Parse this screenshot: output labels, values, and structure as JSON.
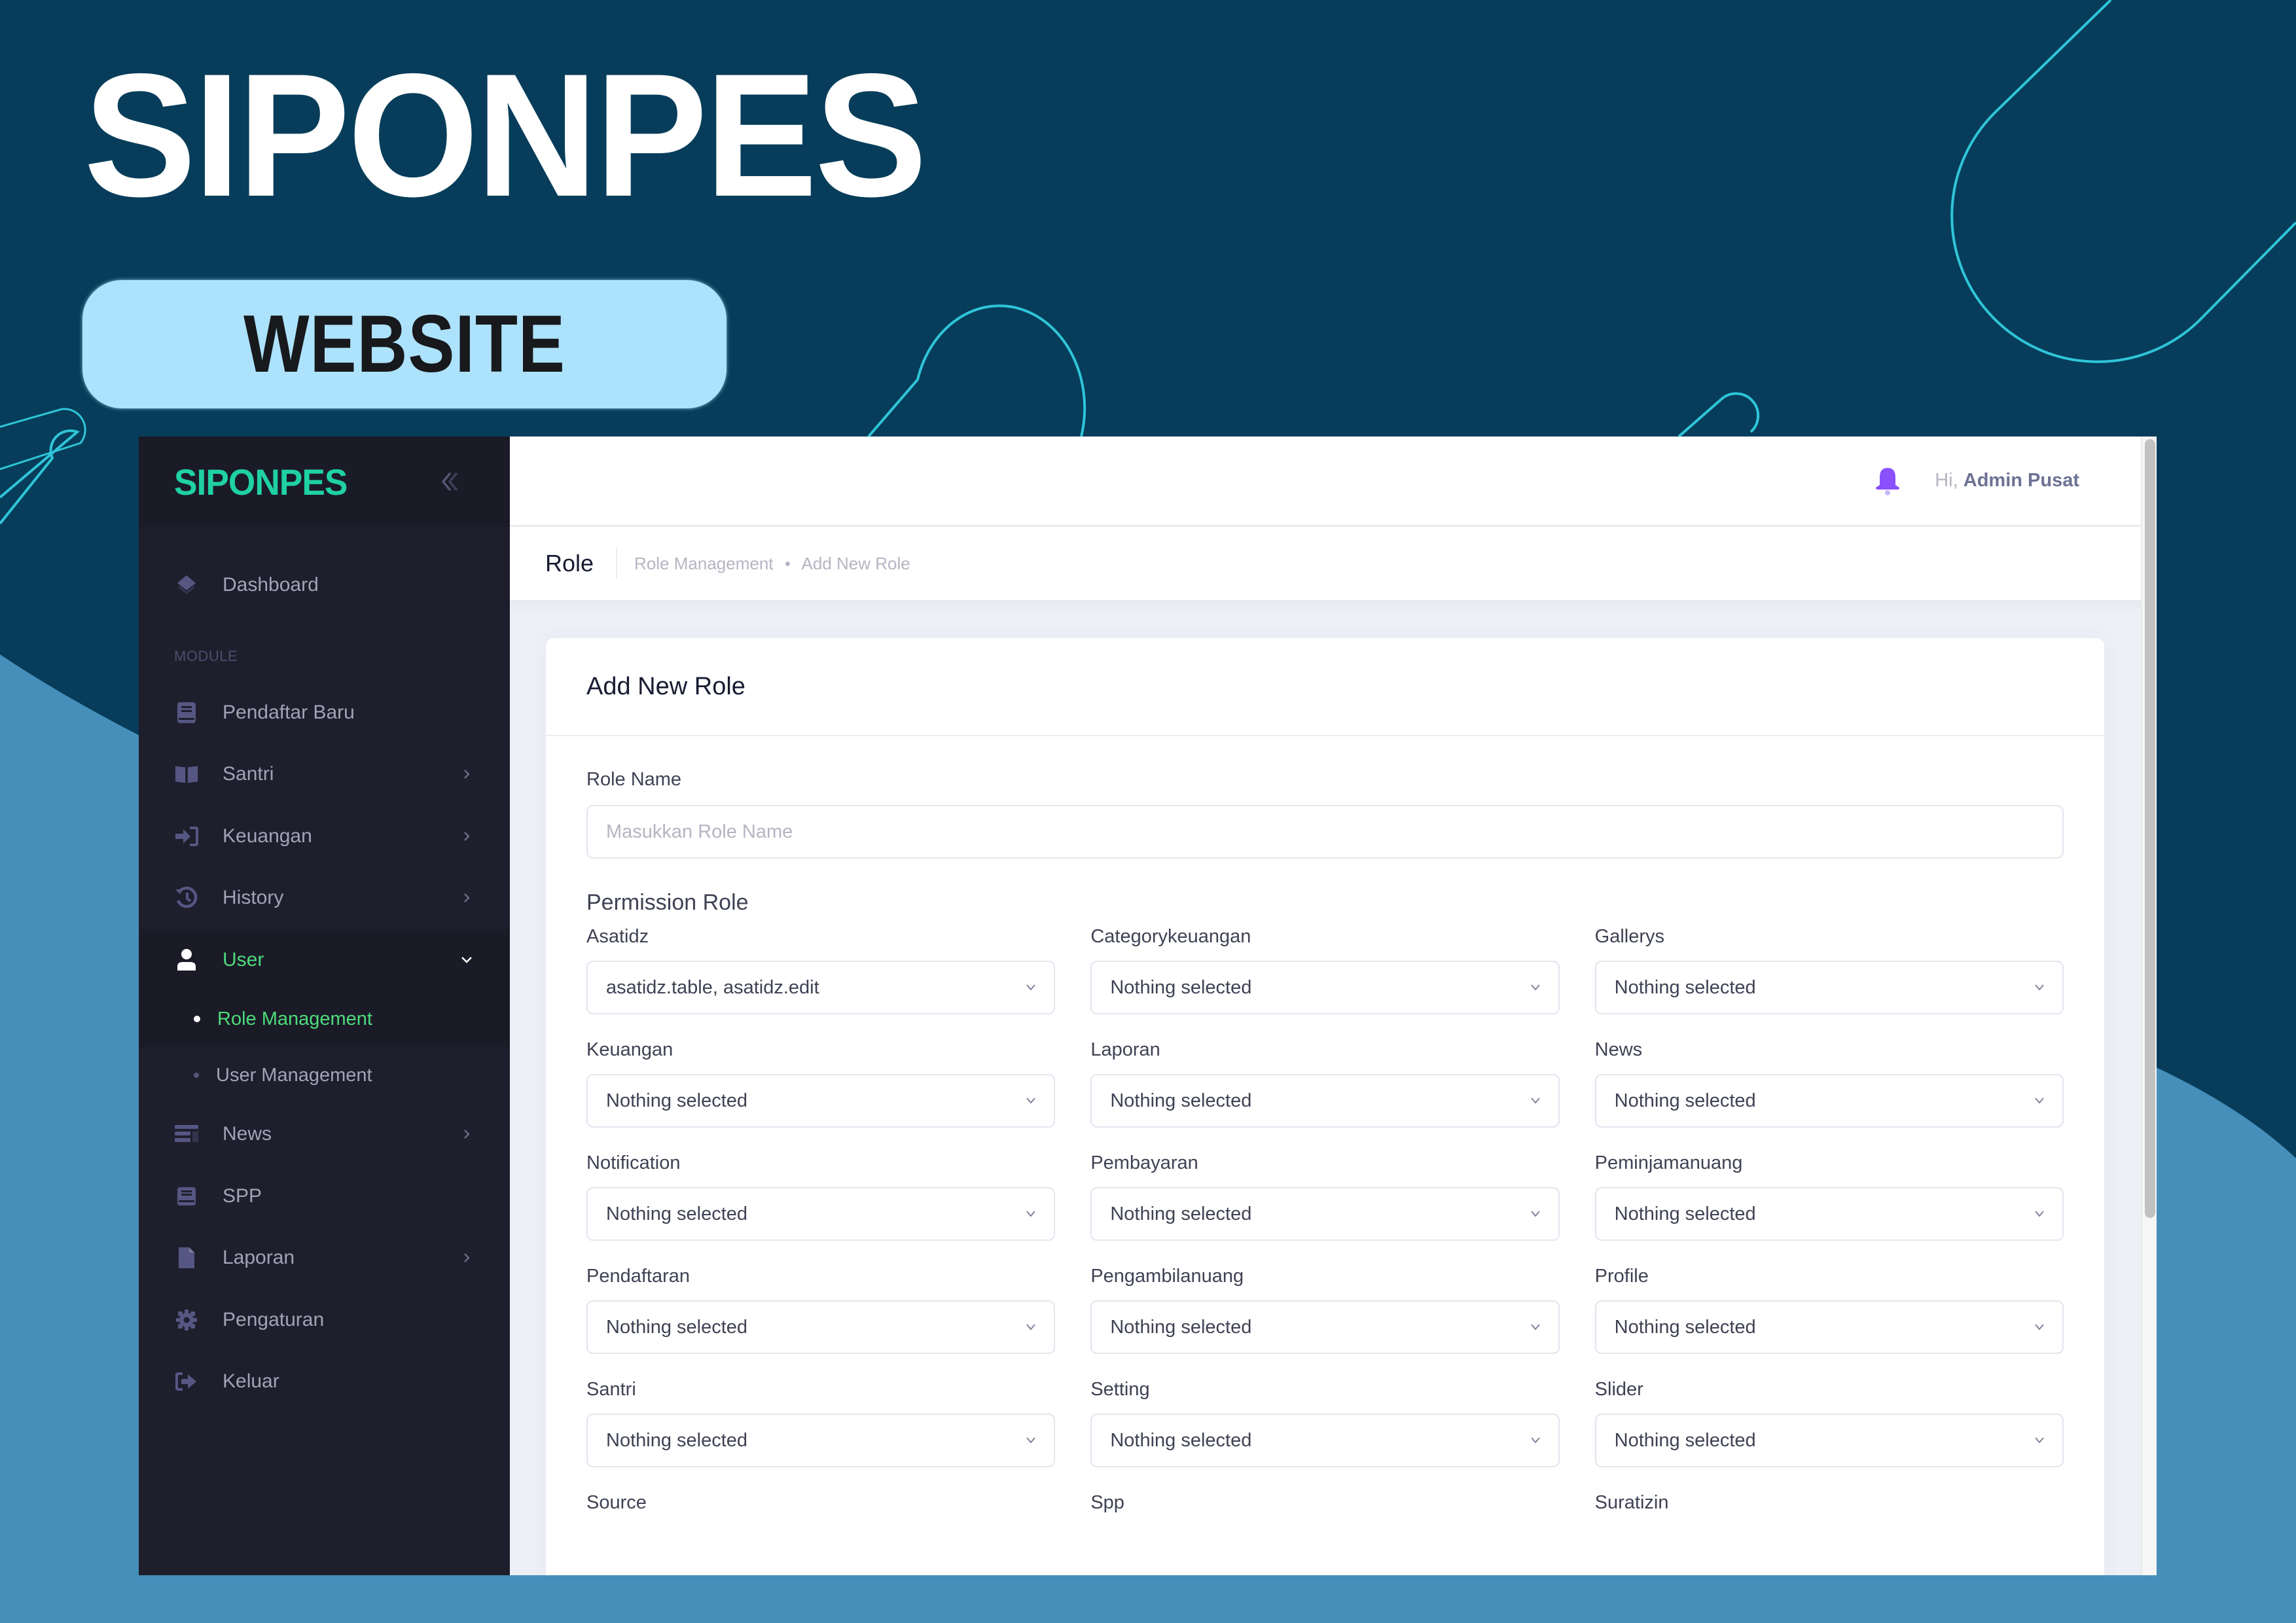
{
  "banner": {
    "title": "SIPONPES",
    "subtitle": "WEBSITE"
  },
  "colors": {
    "background_dark": "#073d5a",
    "background_light": "#468fbb",
    "decoration_stroke": "#2fc5d8",
    "pill": "#ade2fc",
    "brand_green": "#1fd1a4",
    "active_green": "#4ddb7a",
    "bell_purple": "#8950fc",
    "sidebar_bg": "#1e1e2d"
  },
  "sidebar": {
    "logo": "SIPONPES",
    "collapse_icon": "double-chevron-left-icon",
    "dashboard": {
      "label": "Dashboard",
      "icon": "layers-icon"
    },
    "section_label": "MODULE",
    "items": [
      {
        "label": "Pendaftar Baru",
        "icon": "book-icon",
        "has_submenu": false
      },
      {
        "label": "Santri",
        "icon": "open-book-icon",
        "has_submenu": true
      },
      {
        "label": "Keuangan",
        "icon": "sign-in-icon",
        "has_submenu": true
      },
      {
        "label": "History",
        "icon": "history-icon",
        "has_submenu": true
      },
      {
        "label": "User",
        "icon": "user-icon",
        "has_submenu": true,
        "expanded": true,
        "active": true
      },
      {
        "label": "News",
        "icon": "news-icon",
        "has_submenu": true
      },
      {
        "label": "SPP",
        "icon": "book-icon",
        "has_submenu": false
      },
      {
        "label": "Laporan",
        "icon": "file-icon",
        "has_submenu": true
      },
      {
        "label": "Pengaturan",
        "icon": "gear-icon",
        "has_submenu": false
      },
      {
        "label": "Keluar",
        "icon": "sign-out-icon",
        "has_submenu": false
      }
    ],
    "user_submenu": [
      {
        "label": "Role Management",
        "active": true
      },
      {
        "label": "User Management",
        "active": false
      }
    ]
  },
  "topbar": {
    "notification_icon": "bell-icon",
    "greeting": "Hi,",
    "user_name": "Admin Pusat"
  },
  "subheader": {
    "title": "Role",
    "breadcrumb": [
      "Role Management",
      "Add New Role"
    ]
  },
  "form": {
    "card_title": "Add New Role",
    "role_name": {
      "label": "Role Name",
      "placeholder": "Masukkan Role Name",
      "value": ""
    },
    "permission_title": "Permission Role",
    "permissions": [
      {
        "label": "Asatidz",
        "value": "asatidz.table, asatidz.edit"
      },
      {
        "label": "Categorykeuangan",
        "value": "Nothing selected"
      },
      {
        "label": "Gallerys",
        "value": "Nothing selected"
      },
      {
        "label": "Keuangan",
        "value": "Nothing selected"
      },
      {
        "label": "Laporan",
        "value": "Nothing selected"
      },
      {
        "label": "News",
        "value": "Nothing selected"
      },
      {
        "label": "Notification",
        "value": "Nothing selected"
      },
      {
        "label": "Pembayaran",
        "value": "Nothing selected"
      },
      {
        "label": "Peminjamanuang",
        "value": "Nothing selected"
      },
      {
        "label": "Pendaftaran",
        "value": "Nothing selected"
      },
      {
        "label": "Pengambilanuang",
        "value": "Nothing selected"
      },
      {
        "label": "Profile",
        "value": "Nothing selected"
      },
      {
        "label": "Santri",
        "value": "Nothing selected"
      },
      {
        "label": "Setting",
        "value": "Nothing selected"
      },
      {
        "label": "Slider",
        "value": "Nothing selected"
      },
      {
        "label": "Source",
        "value": ""
      },
      {
        "label": "Spp",
        "value": ""
      },
      {
        "label": "Suratizin",
        "value": ""
      }
    ]
  }
}
